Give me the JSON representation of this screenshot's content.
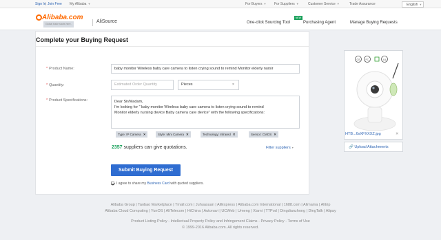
{
  "topbar": {
    "sign_in": "Sign In",
    "join_free": "Join Free",
    "my_alibaba": "My Alibaba",
    "for_buyers": "For Buyers",
    "for_suppliers": "For Suppliers",
    "customer_service": "Customer Service",
    "trade_assurance": "Trade Assurance",
    "language": "English"
  },
  "header": {
    "logo_text": "Alibaba.com",
    "logo_tagline": "Global trade starts here.",
    "product": "AliSource",
    "nav": {
      "one_click": "One-click Sourcing Tool",
      "new_badge": "NEW",
      "purchasing_agent": "Purchasing Agent",
      "manage_requests": "Manage Buying Requests"
    }
  },
  "form": {
    "title": "Complete your Buying Request",
    "product_name_label": "Product Name:",
    "product_name_value": "baby monitor Wireless baby care camera to listen crying sound to remind Monitor elderly nursir",
    "quantity_label": "Quantity:",
    "quantity_placeholder": "Estimated Order Quantity",
    "unit_value": "Pieces",
    "specs_label": "Product Specifications:",
    "specs_lines": [
      "Dear Sir/Madam,",
      "I'm looking for \" baby monitor Wireless baby care camera to listen crying sound to remind",
      "Monitor elderly nursing device Baby camera care device\" with the following specifications:"
    ],
    "tags": [
      "Type: IP Camera",
      "Style: Mini Camera",
      "Technology: Infrared",
      "Sensor: CMOS"
    ],
    "supplier_count": "2357",
    "supplier_text": "suppliers can give quotations.",
    "filter_label": "Filter suppliers",
    "submit_label": "Submit Buying Request",
    "agree_prefix": "I agree to share my",
    "agree_link": "Business Card",
    "agree_suffix": "with quoted suppliers."
  },
  "attachment": {
    "file_name": "HTB...6xXFXXXZ.jpg",
    "upload_label": "Upload Attachments"
  },
  "footer": {
    "line1": "Alibaba Group | Taobao Marketplace | Tmall.com | Juhuasuan | AliExpress | Alibaba.com International | 1688.com | Alimama | Alitrip",
    "line2": "Alibaba Cloud Computing | YunOS | AliTelecom | HiChina | Autonavi | UCWeb | Umeng | Xiami | TTPod | Dingdianzhong | DingTalk | Alipay",
    "line3": "Product Listing Policy - Intellectual Property Policy and Infringement Claims - Privacy Policy - Terms of Use",
    "line4": "© 1999-2016 Alibaba.com. All rights reserved."
  }
}
